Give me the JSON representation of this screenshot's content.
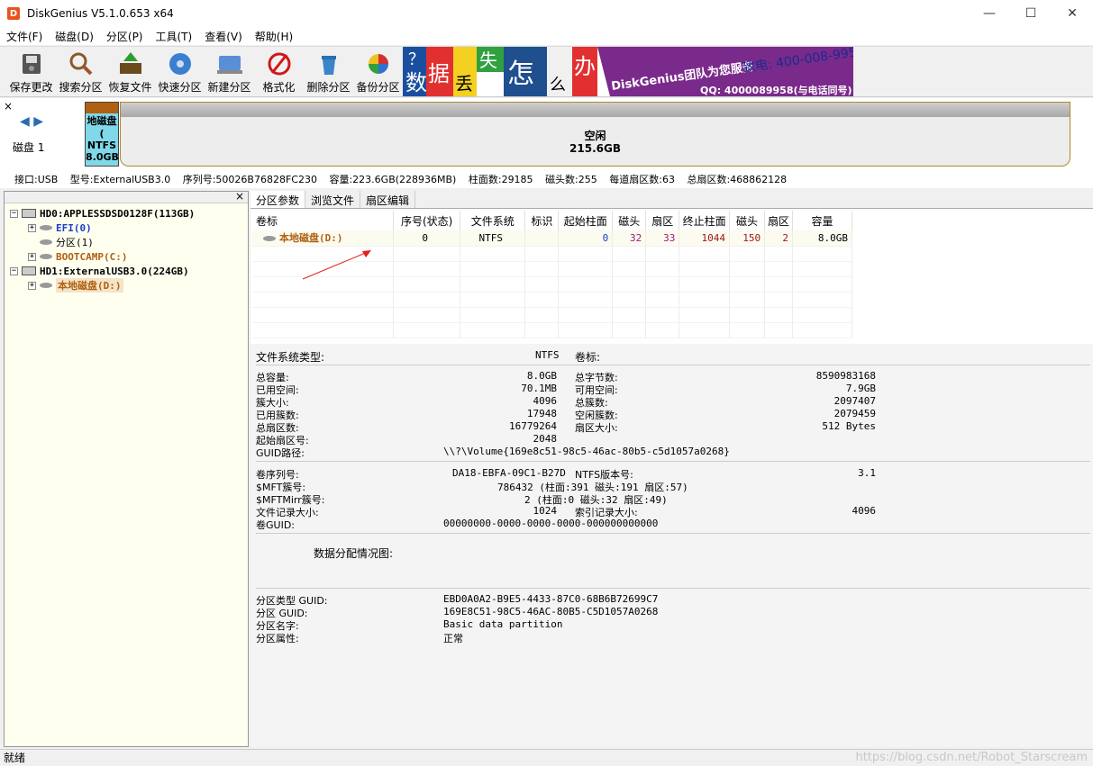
{
  "window": {
    "app_icon_glyph": "D",
    "title": "DiskGenius V5.1.0.653 x64",
    "minimize": "—",
    "maximize": "☐",
    "close": "✕"
  },
  "menu": [
    "文件(F)",
    "磁盘(D)",
    "分区(P)",
    "工具(T)",
    "查看(V)",
    "帮助(H)"
  ],
  "toolbar": [
    {
      "label": "保存更改",
      "icon": "save-icon"
    },
    {
      "label": "搜索分区",
      "icon": "search-icon"
    },
    {
      "label": "恢复文件",
      "icon": "recover-icon"
    },
    {
      "label": "快速分区",
      "icon": "quick-partition-icon"
    },
    {
      "label": "新建分区",
      "icon": "new-partition-icon"
    },
    {
      "label": "格式化",
      "icon": "format-icon"
    },
    {
      "label": "删除分区",
      "icon": "delete-icon"
    },
    {
      "label": "备份分区",
      "icon": "backup-icon"
    }
  ],
  "banner": {
    "chars": [
      "数",
      "据",
      "丢",
      "失",
      "怎",
      "么",
      "办"
    ],
    "question_mark": "？",
    "ad_text": "DiskGenius团队为您服务",
    "phone": "致电: 400-008-9958",
    "qq": "QQ: 4000089958(与电话同号)"
  },
  "disk_map": {
    "close": "×",
    "nav": "◀ ▶",
    "disk_label": "磁盘 1",
    "part_d": {
      "name": "地磁盘(",
      "fs": "NTFS",
      "size": "8.0GB"
    },
    "free": {
      "label": "空闲",
      "size": "215.6GB"
    },
    "info": [
      "接口:USB",
      "型号:ExternalUSB3.0",
      "序列号:50026B76828FC230",
      "容量:223.6GB(228936MB)",
      "柱面数:29185",
      "磁头数:255",
      "每道扇区数:63",
      "总扇区数:468862128"
    ]
  },
  "tree": {
    "close": "×",
    "items": [
      {
        "label": "HD0:APPLESSDSD0128F(113GB)",
        "color": "#000000",
        "expander": "−"
      },
      {
        "label": "EFI(0)",
        "color": "#1a3fc4",
        "expander": "+"
      },
      {
        "label": "分区(1)",
        "color": "#000000",
        "expander": ""
      },
      {
        "label": "BOOTCAMP(C:)",
        "color": "#b06010",
        "expander": "+"
      },
      {
        "label": "HD1:ExternalUSB3.0(224GB)",
        "color": "#000000",
        "expander": "−"
      },
      {
        "label": "本地磁盘(D:)",
        "color": "#b06010",
        "expander": "+"
      }
    ]
  },
  "tabs": [
    "分区参数",
    "浏览文件",
    "扇区编辑"
  ],
  "table": {
    "headers": [
      "卷标",
      "序号(状态)",
      "文件系统",
      "标识",
      "起始柱面",
      "磁头",
      "扇区",
      "终止柱面",
      "磁头",
      "扇区",
      "容量"
    ],
    "row": [
      "本地磁盘(D:)",
      "0",
      "NTFS",
      "",
      "0",
      "32",
      "33",
      "1044",
      "150",
      "2",
      "8.0GB"
    ]
  },
  "info": {
    "fs_type_label": "文件系统类型:",
    "fs_type": "NTFS",
    "vol_label_label": "卷标:",
    "total_cap_label": "总容量:",
    "total_cap": "8.0GB",
    "total_bytes_label": "总字节数:",
    "total_bytes": "8590983168",
    "used_label": "已用空间:",
    "used": "70.1MB",
    "free_label": "可用空间:",
    "free": "7.9GB",
    "cluster_size_label": "簇大小:",
    "cluster_size": "4096",
    "total_clusters_label": "总簇数:",
    "total_clusters": "2097407",
    "used_clusters_label": "已用簇数:",
    "used_clusters": "17948",
    "free_clusters_label": "空闲簇数:",
    "free_clusters": "2079459",
    "total_sectors_label": "总扇区数:",
    "total_sectors": "16779264",
    "sector_size_label": "扇区大小:",
    "sector_size": "512 Bytes",
    "start_sector_label": "起始扇区号:",
    "start_sector": "2048",
    "guid_path_label": "GUID路径:",
    "guid_path": "\\\\?\\Volume{169e8c51-98c5-46ac-80b5-c5d1057a0268}",
    "serial_label": "卷序列号:",
    "serial": "DA18-EBFA-09C1-B27D",
    "ntfs_ver_label": "NTFS版本号:",
    "ntfs_ver": "3.1",
    "mft_label": "$MFT簇号:",
    "mft": "786432 (柱面:391 磁头:191 扇区:57)",
    "mftmirr_label": "$MFTMirr簇号:",
    "mftmirr": "2 (柱面:0 磁头:32 扇区:49)",
    "record_size_label": "文件记录大小:",
    "record_size": "1024",
    "index_size_label": "索引记录大小:",
    "index_size": "4096",
    "vol_guid_label": "卷GUID:",
    "vol_guid": "00000000-0000-0000-0000-000000000000",
    "alloc_map_label": "数据分配情况图:",
    "ptype_guid_label": "分区类型 GUID:",
    "ptype_guid": "EBD0A0A2-B9E5-4433-87C0-68B6B72699C7",
    "p_guid_label": "分区 GUID:",
    "p_guid": "169E8C51-98C5-46AC-80B5-C5D1057A0268",
    "p_name_label": "分区名字:",
    "p_name": "Basic data partition",
    "p_attr_label": "分区属性:",
    "p_attr": "正常"
  },
  "status": {
    "text": "就绪",
    "watermark": "https://blog.csdn.net/Robot_Starscream"
  }
}
